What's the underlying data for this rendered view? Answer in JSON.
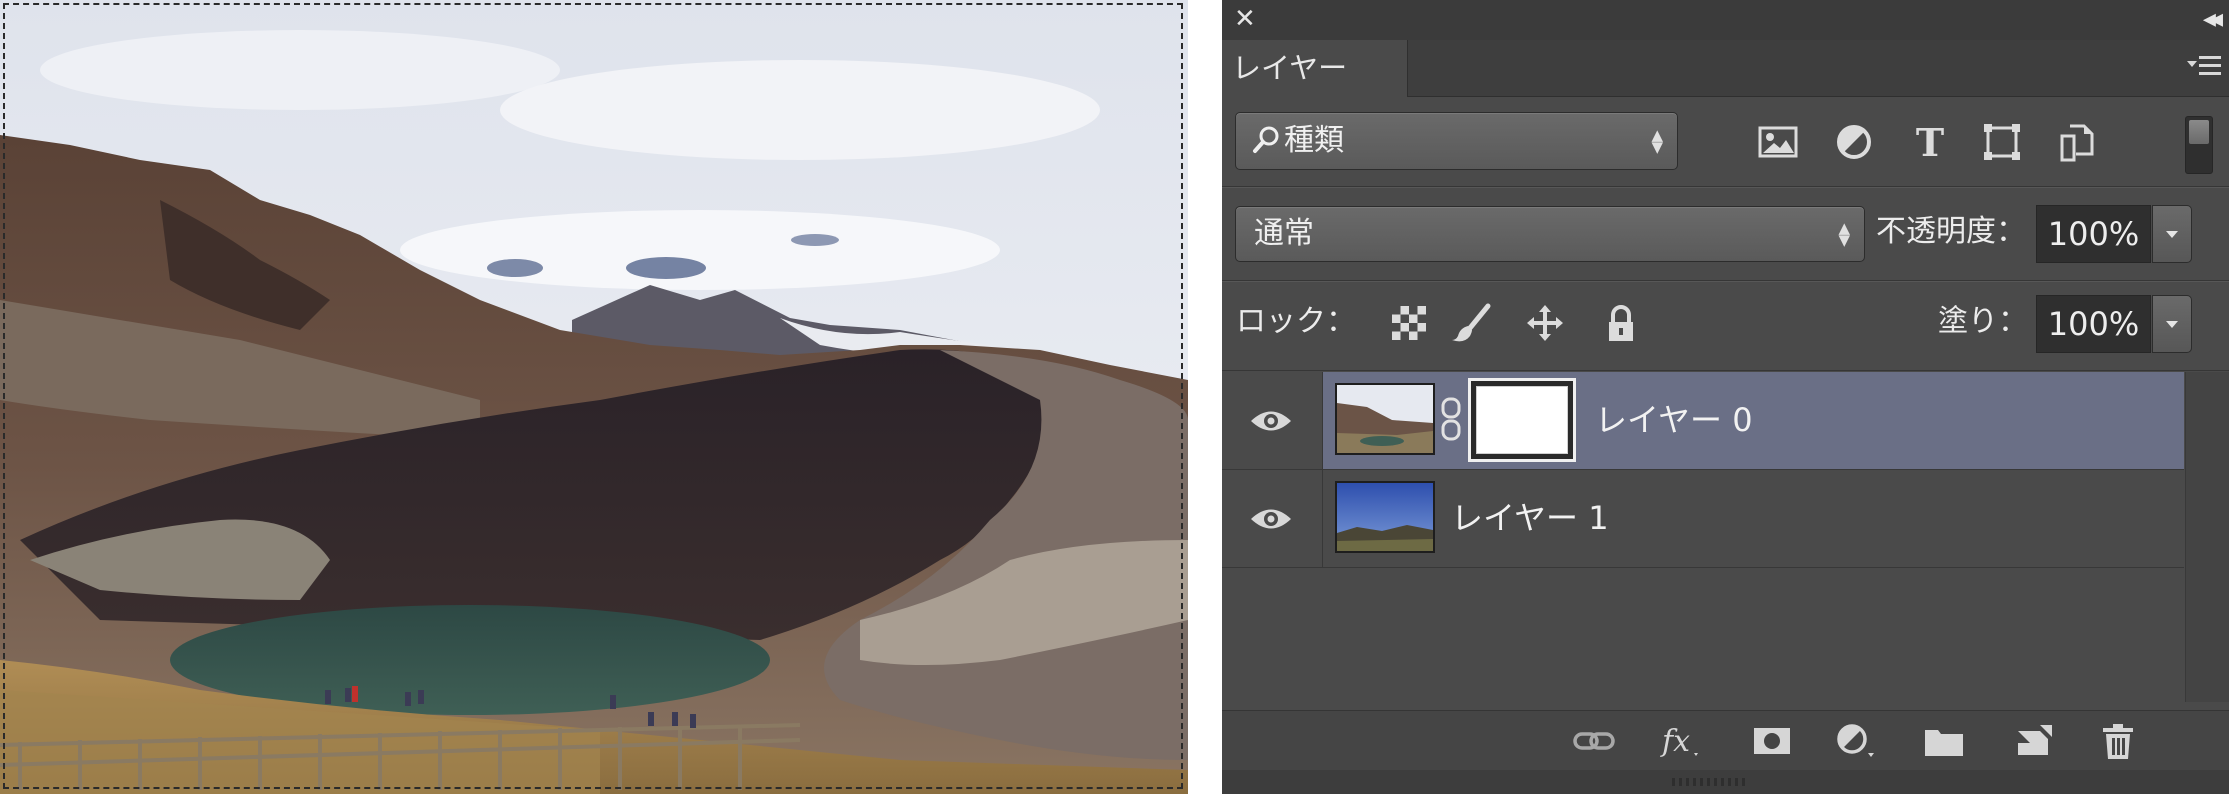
{
  "canvas": {
    "image_subject": "mountain-crater-lake-photo",
    "selection": "marching-ants"
  },
  "panel": {
    "close_glyph": "✕",
    "collapse_glyph": "◂◂",
    "tab_label": "レイヤー",
    "filter": {
      "label": "種類",
      "icons": [
        "image-filter-icon",
        "adjustment-filter-icon",
        "type-filter-icon",
        "shape-filter-icon",
        "smart-object-filter-icon"
      ]
    },
    "blend_mode": "通常",
    "opacity_label": "不透明度：",
    "opacity_value": "100%",
    "lock_label": "ロック：",
    "lock_icons": [
      "lock-transparent-pixels-icon",
      "lock-image-pixels-icon",
      "lock-position-icon",
      "lock-all-icon"
    ],
    "fill_label": "塗り：",
    "fill_value": "100%",
    "layers": [
      {
        "name": "レイヤー 0",
        "visible": true,
        "selected": true,
        "has_mask": true,
        "thumb": "mountain-photo"
      },
      {
        "name": "レイヤー 1",
        "visible": true,
        "selected": false,
        "has_mask": false,
        "thumb": "blue-sky-landscape"
      }
    ],
    "bottom_icons": [
      "link-layers-icon",
      "fx-icon",
      "add-mask-icon",
      "new-adjustment-layer-icon",
      "new-group-icon",
      "new-layer-icon",
      "delete-layer-icon"
    ],
    "colors": {
      "panel_bg": "#4a4a4a",
      "selected_row": "#6a6f86",
      "field_bg": "#2f2f2f"
    }
  }
}
